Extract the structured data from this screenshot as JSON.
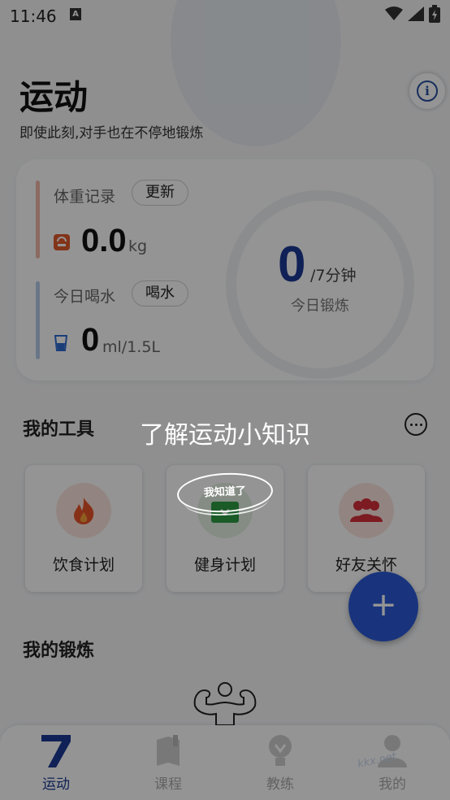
{
  "status_bar": {
    "time": "11:46",
    "notification": "A"
  },
  "header": {
    "title": "运动",
    "subtitle": "即使此刻,对手也在不停地锻炼"
  },
  "summary": {
    "weight": {
      "label": "体重记录",
      "action": "更新",
      "value": "0.0",
      "unit": "kg"
    },
    "water": {
      "label": "今日喝水",
      "action": "喝水",
      "value": "0",
      "unit": "ml/1.5L"
    },
    "exercise": {
      "value": "0",
      "total": "/7分钟",
      "label": "今日锻炼",
      "progress": 0
    }
  },
  "tools": {
    "title": "我的工具",
    "items": [
      {
        "label": "饮食计划",
        "icon": "fire-icon"
      },
      {
        "label": "健身计划",
        "icon": "plan-icon"
      },
      {
        "label": "好友关怀",
        "icon": "group-icon"
      }
    ]
  },
  "workouts": {
    "title": "我的锻炼"
  },
  "guide": {
    "text": "了解运动小知识",
    "button": "我知道了"
  },
  "tabs": [
    {
      "label": "运动",
      "icon": "seven-icon",
      "active": true
    },
    {
      "label": "课程",
      "icon": "book-icon",
      "active": false
    },
    {
      "label": "教练",
      "icon": "coach-icon",
      "active": false
    },
    {
      "label": "我的",
      "icon": "profile-icon",
      "active": false
    }
  ],
  "colors": {
    "accent": "#1a3a94",
    "fab": "#2c5bd8",
    "weight_bar": "#f0b9a8",
    "water_bar": "#b6cbe8"
  }
}
